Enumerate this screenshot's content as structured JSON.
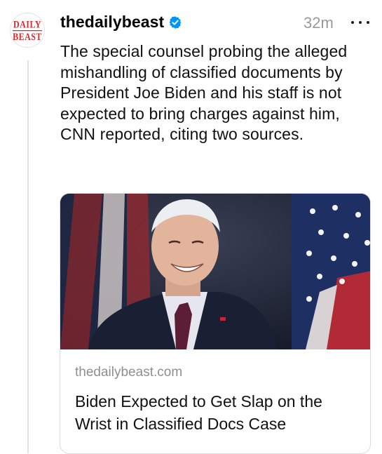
{
  "post": {
    "avatar": {
      "logo_line1": "DAILY",
      "logo_line2": "BEAST",
      "brand_color": "#e0262b"
    },
    "username": "thedailybeast",
    "verified_icon": "verified-badge-icon",
    "verified_color": "#0095f6",
    "timestamp": "32m",
    "more_icon": "more-options-icon",
    "text": "The special counsel probing the alleged mishandling of classified documents by President Joe Biden and his staff is not expected to bring charges against him, CNN reported, citing two sources."
  },
  "link_card": {
    "domain": "thedailybeast.com",
    "title": "Biden Expected to Get Slap on the Wrist in Classified Docs Case"
  }
}
